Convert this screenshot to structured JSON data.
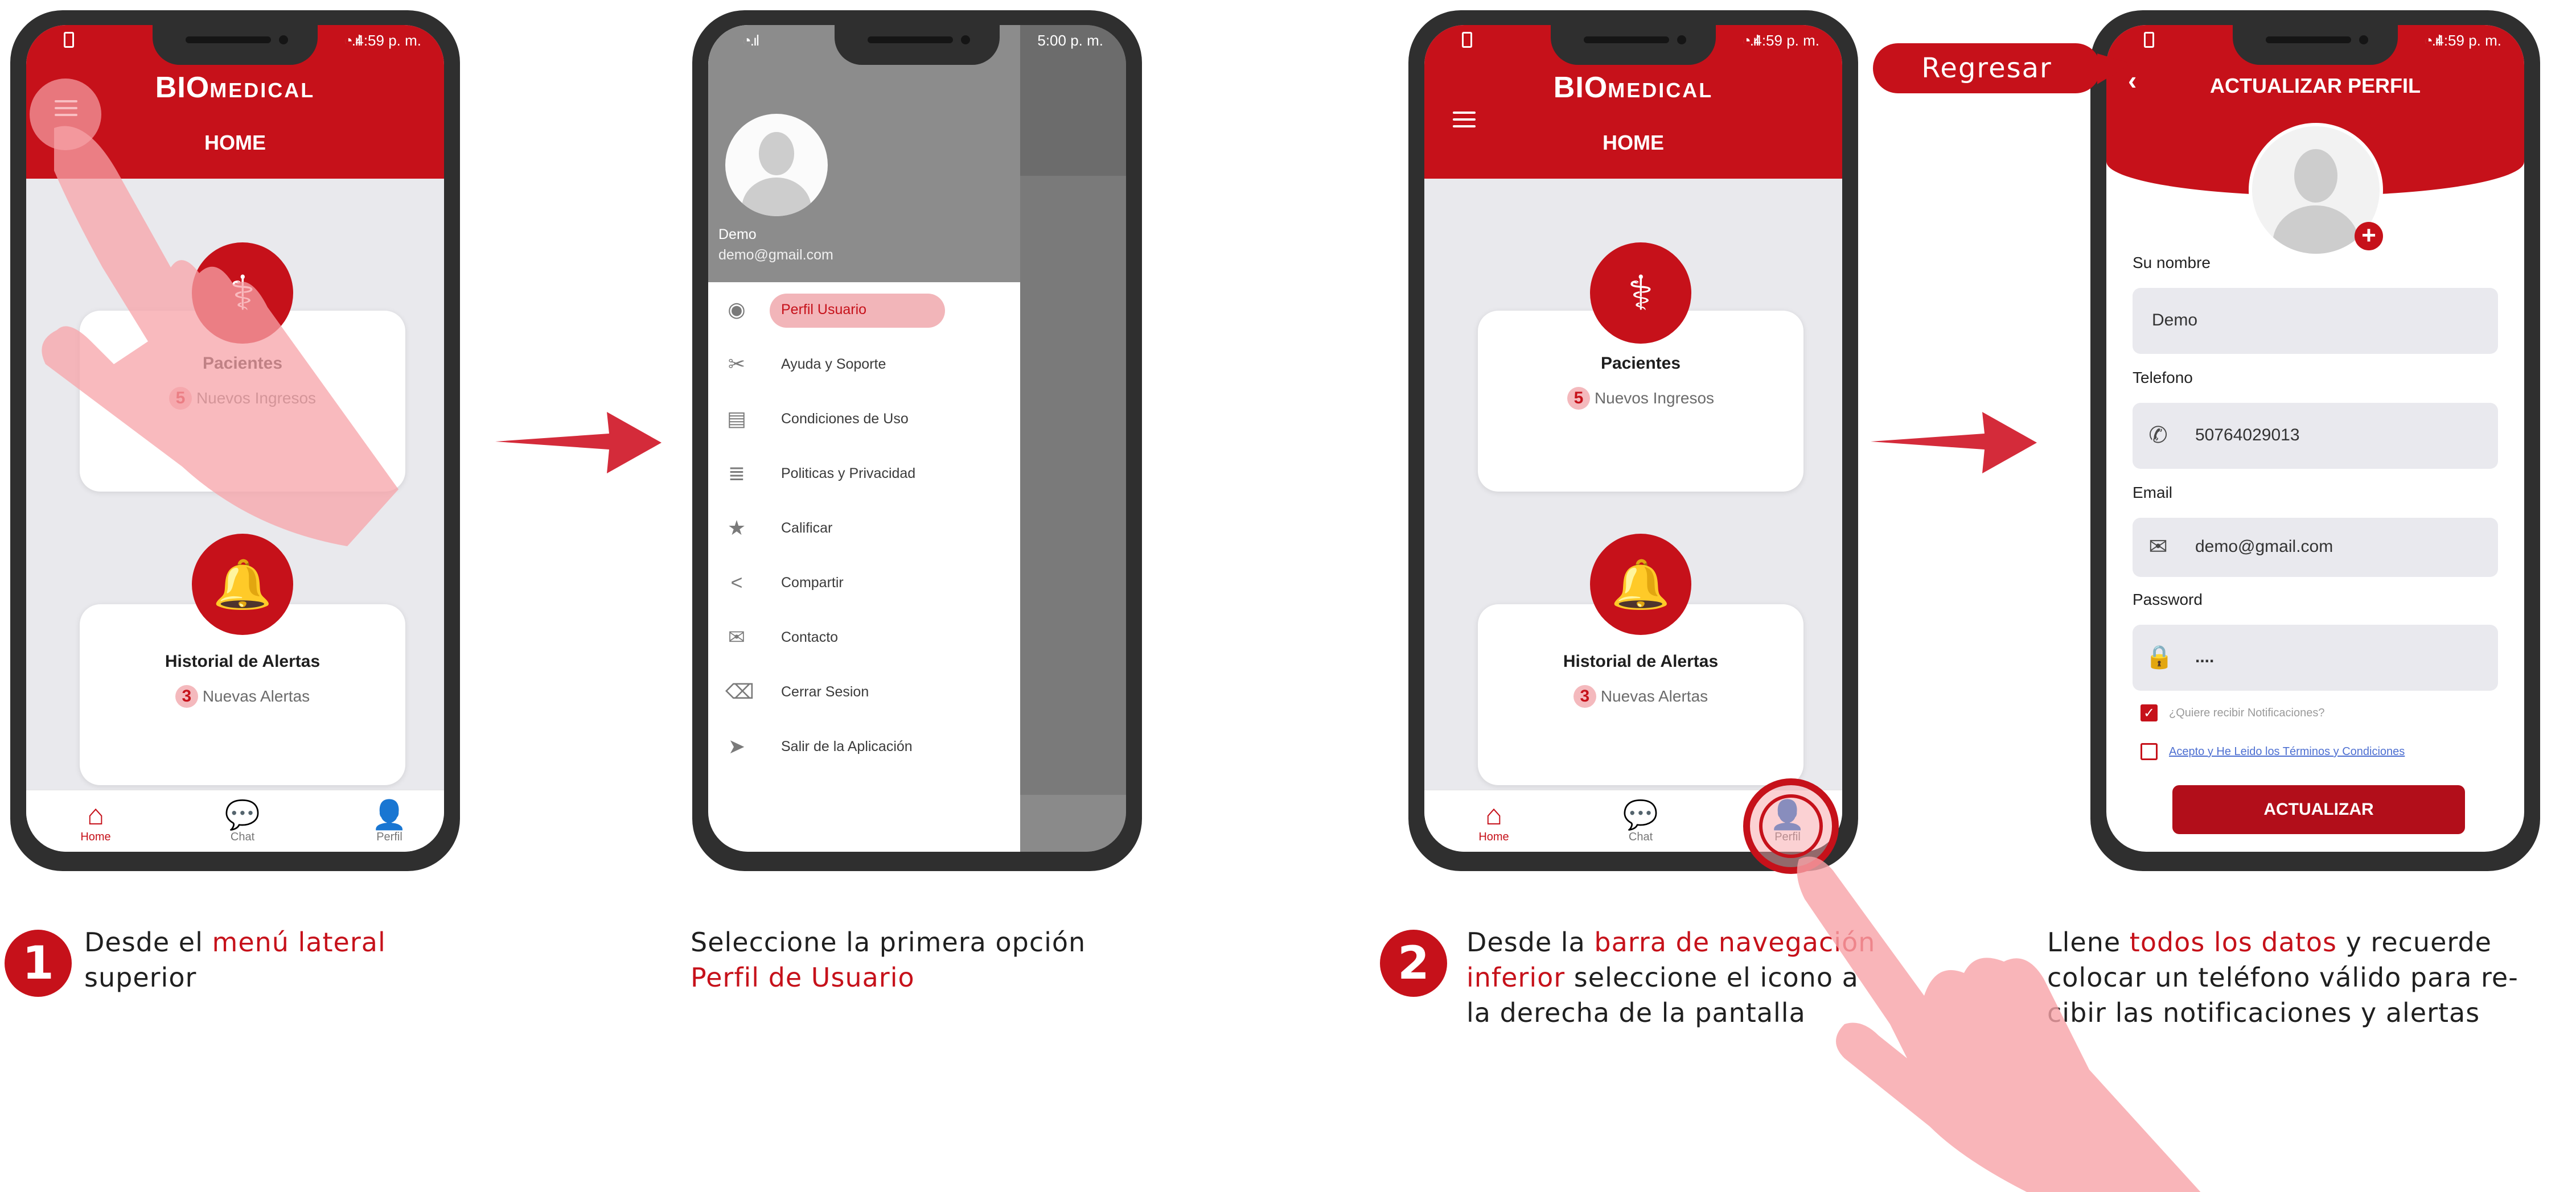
{
  "colors": {
    "brand_red": "#c6111a",
    "hand_pink": "#f7a3a8"
  },
  "status": {
    "time_1": "4:59 p. m.",
    "time_2": "5:00 p. m.",
    "time_3": "4:59 p. m.",
    "time_4": "4:59 p. m."
  },
  "logo": {
    "bio": "BIO",
    "medical": "MEDICAL"
  },
  "home": {
    "title": "HOME",
    "card1_title": "Pacientes",
    "card1_count": "5",
    "card1_sub": "Nuevos Ingresos",
    "card2_title": "Historial de Alertas",
    "card2_count": "3",
    "card2_sub": "Nuevas Alertas"
  },
  "nav": {
    "home": "Home",
    "chat": "Chat",
    "perfil": "Perfil"
  },
  "drawer": {
    "name": "Demo",
    "email": "demo@gmail.com",
    "items": [
      {
        "label": "Perfil Usuario",
        "icon": "account-circle-icon"
      },
      {
        "label": "Ayuda y Soporte",
        "icon": "tools-icon"
      },
      {
        "label": "Condiciones de Uso",
        "icon": "document-check-icon"
      },
      {
        "label": "Politicas y Privacidad",
        "icon": "scroll-icon"
      },
      {
        "label": "Calificar",
        "icon": "star-icon"
      },
      {
        "label": "Compartir",
        "icon": "share-icon"
      },
      {
        "label": "Contacto",
        "icon": "mail-icon"
      },
      {
        "label": "Cerrar Sesion",
        "icon": "backspace-icon"
      },
      {
        "label": "Salir de la Aplicación",
        "icon": "send-icon"
      }
    ]
  },
  "profile": {
    "title": "ACTUALIZAR PERFIL",
    "name_label": "Su nombre",
    "name_value": "Demo",
    "phone_label": "Telefono",
    "phone_value": "50764029013",
    "email_label": "Email",
    "email_value": "demo@gmail.com",
    "password_label": "Password",
    "password_value": "....",
    "notif_text": "¿Quiere recibir Notificaciones?",
    "terms_text": "Acepto y He Leido los Términos y Condiciones",
    "button": "ACTUALIZAR"
  },
  "callout": {
    "regresar": "Regresar"
  },
  "steps": {
    "step1_number": "1",
    "step1_a": "Desde el ",
    "step1_hl": "menú lateral",
    "step1_b": "superior",
    "step1b_a": "Seleccione la primera opción",
    "step1b_hl": "Perfil de Usuario",
    "step2_number": "2",
    "step2_a": "Desde la ",
    "step2_hl1": "barra de navegación",
    "step2_hl2": "inferior",
    "step2_b": " seleccione el icono a",
    "step2_c": "la derecha de la pantalla",
    "step2b_a": "Llene ",
    "step2b_hl": "todos los datos",
    "step2b_b": " y recuerde",
    "step2b_c": "colocar un teléfono válido para re-",
    "step2b_d": "cibir las notificaciones y alertas"
  }
}
